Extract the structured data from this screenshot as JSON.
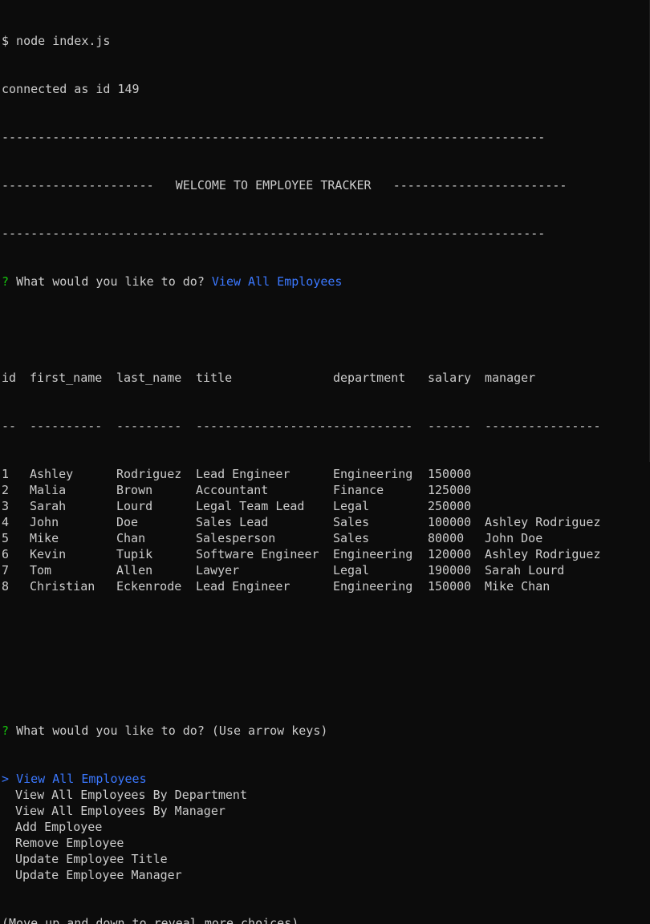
{
  "terminal": {
    "command_line": "$ node index.js",
    "connected_line": "connected as id 149",
    "divider": "---------------------------------------------------------------------------",
    "banner_left": "---------------------",
    "banner_title": "WELCOME TO EMPLOYEE TRACKER",
    "banner_right": "------------------------",
    "prompt_mark": "?",
    "prompt_question": "What would you like to do?",
    "prompt_answer": "View All Employees",
    "table": {
      "headers": [
        "id",
        "first_name",
        "last_name",
        "title",
        "department",
        "salary",
        "manager"
      ],
      "separators": [
        "--",
        "----------",
        "---------",
        "-------------------",
        "-----------",
        "------",
        "----------------"
      ],
      "rows": [
        [
          "1",
          "Ashley",
          "Rodriguez",
          "Lead Engineer",
          "Engineering",
          "150000",
          ""
        ],
        [
          "2",
          "Malia",
          "Brown",
          "Accountant",
          "Finance",
          "125000",
          ""
        ],
        [
          "3",
          "Sarah",
          "Lourd",
          "Legal Team Lead",
          "Legal",
          "250000",
          ""
        ],
        [
          "4",
          "John",
          "Doe",
          "Sales Lead",
          "Sales",
          "100000",
          "Ashley Rodriguez"
        ],
        [
          "5",
          "Mike",
          "Chan",
          "Salesperson",
          "Sales",
          "80000",
          "John Doe"
        ],
        [
          "6",
          "Kevin",
          "Tupik",
          "Software Engineer",
          "Engineering",
          "120000",
          "Ashley Rodriguez"
        ],
        [
          "7",
          "Tom",
          "Allen",
          "Lawyer",
          "Legal",
          "190000",
          "Sarah Lourd"
        ],
        [
          "8",
          "Christian",
          "Eckenrode",
          "Lead Engineer",
          "Engineering",
          "150000",
          "Mike Chan"
        ]
      ]
    },
    "prompt2_question": "What would you like to do? (Use arrow keys)",
    "menu_pointer": ">",
    "menu": [
      "View All Employees",
      "View All Employees By Department",
      "View All Employees By Manager",
      "Add Employee",
      "Remove Employee",
      "Update Employee Title",
      "Update Employee Manager"
    ],
    "selected_index": 0,
    "hint": "(Move up and down to reveal more choices)",
    "colors": {
      "background": "#0c0c0c",
      "text": "#cccccc",
      "prompt_mark": "#16c60c",
      "highlight": "#3b78ff"
    }
  }
}
